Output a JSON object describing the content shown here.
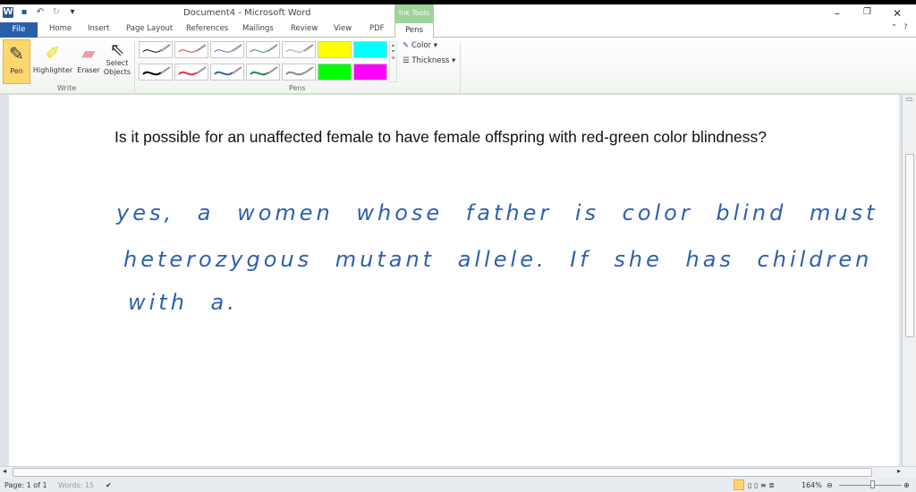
{
  "window": {
    "title": "Document4  -  Microsoft Word",
    "context_tab_group": "Ink Tools"
  },
  "tabs": [
    "File",
    "Home",
    "Insert",
    "Page Layout",
    "References",
    "Mailings",
    "Review",
    "View",
    "PDF",
    "Pens"
  ],
  "ribbon": {
    "write_group": {
      "label": "Write",
      "buttons": [
        "Pen",
        "Highlighter",
        "Eraser",
        "Select Objects"
      ]
    },
    "pens_group": {
      "label": "Pens",
      "color_label": "Color",
      "thickness_label": "Thickness"
    },
    "pen_swatches": [
      "#000000",
      "#e0303a",
      "#4a6fc0",
      "#2a8a4a",
      "#999999",
      "#ffff00",
      "#00ffff",
      "#000000",
      "#e0303a",
      "#3a60b8",
      "#1f8a40",
      "#888888",
      "#00ff00",
      "#ff00ff"
    ]
  },
  "document": {
    "question": "Is it possible for an unaffected female to have female offspring with red-green color blindness?",
    "handwriting": [
      "yes, a women whose father is color blind must be",
      "heterozygous mutant allele. If she has children",
      "with a."
    ],
    "ink_color": "#2f5fb0"
  },
  "status": {
    "page": "Page: 1 of 1",
    "words": "Words: 15",
    "zoom": "164%"
  }
}
